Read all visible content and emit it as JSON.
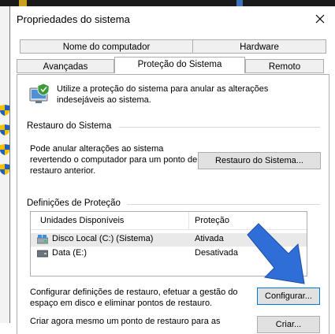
{
  "window": {
    "title": "Propriedades do sistema"
  },
  "tabs": {
    "row1": [
      {
        "label": "Nome do computador"
      },
      {
        "label": "Hardware"
      }
    ],
    "row2": [
      {
        "label": "Avançadas"
      },
      {
        "label": "Proteção do Sistema",
        "active": true
      },
      {
        "label": "Remoto"
      }
    ]
  },
  "intro": {
    "line1": "Utilize a proteção do sistema para anular as alterações",
    "line2": "indesejáveis ao sistema."
  },
  "restore": {
    "title": "Restauro do Sistema",
    "line1": "Pode anular alterações ao sistema",
    "line2": "revertendo o computador para um ponto de",
    "line3": "restauro anterior.",
    "button": "Restauro do Sistema..."
  },
  "protection": {
    "title": "Definições de Proteção",
    "columns": [
      "Unidades Disponíveis",
      "Proteção"
    ],
    "rows": [
      {
        "drive": "Disco Local (C:) (Sistema)",
        "status": "Ativada",
        "selected": true
      },
      {
        "drive": "Data (E:)",
        "status": "Desativada",
        "selected": false
      }
    ],
    "configure_line1": "Configurar definições de restauro, efetuar a gestão do",
    "configure_line2": "espaço em disco e eliminar pontos de restauro.",
    "configure_button": "Configurar...",
    "create_line1": "Criar agora mesmo um ponto de restauro para as",
    "create_button": "Criar..."
  },
  "colors": {
    "arrow": "#2f6ed6",
    "focus_border": "#0078d7"
  },
  "icons": {
    "close": "close-icon",
    "system_protection": "system-protection-icon",
    "drive_system": "system-drive-icon",
    "drive_data": "data-drive-icon",
    "annotation_arrow": "blue-arrow-icon",
    "shield": "uac-shield-icon"
  }
}
